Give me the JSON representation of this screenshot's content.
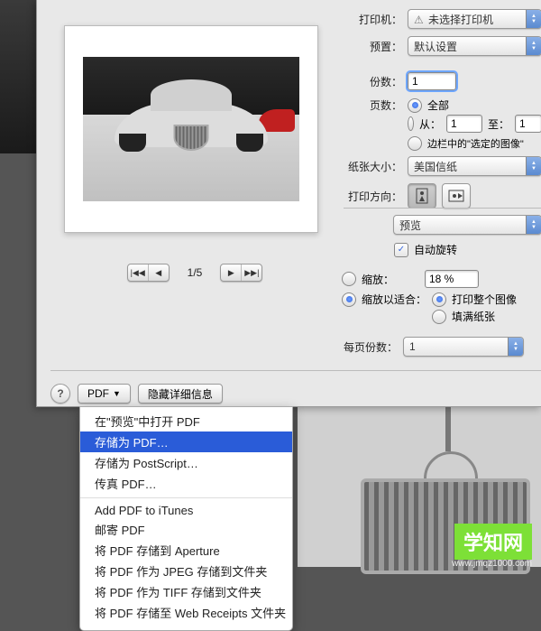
{
  "labels": {
    "printer": "打印机：",
    "preset": "预置：",
    "copies": "份数：",
    "pages": "页数：",
    "paper_size": "纸张大小：",
    "orientation": "打印方向：",
    "copies_per_page": "每页份数："
  },
  "printer": {
    "value": "未选择打印机"
  },
  "preset": {
    "value": "默认设置"
  },
  "copies": {
    "value": "1"
  },
  "pages": {
    "all": "全部",
    "from_label": "从：",
    "from_value": "1",
    "to_label": "至：",
    "to_value": "1",
    "sidebar_select": "边栏中的\"选定的图像\""
  },
  "paper_size": {
    "value": "美国信纸"
  },
  "preview_section": {
    "value": "预览"
  },
  "auto_rotate": "自动旋转",
  "scale": {
    "label": "缩放：",
    "value": "18 %"
  },
  "fit": {
    "label": "缩放以适合：",
    "print_whole": "打印整个图像",
    "fill_paper": "填满纸张"
  },
  "copies_per_page": {
    "value": "1"
  },
  "pager": {
    "text": "1/5"
  },
  "bottom": {
    "pdf_btn": "PDF",
    "hide_details": "隐藏详细信息"
  },
  "menu": {
    "open_in_preview": "在\"预览\"中打开 PDF",
    "save_as_pdf": "存储为 PDF…",
    "save_as_ps": "存储为 PostScript…",
    "fax_pdf": "传真 PDF…",
    "add_to_itunes": "Add PDF to iTunes",
    "mail_pdf": "邮寄 PDF",
    "save_to_aperture": "将 PDF 存储到 Aperture",
    "save_as_jpeg": "将 PDF 作为 JPEG 存储到文件夹",
    "save_as_tiff": "将 PDF 作为 TIFF 存储到文件夹",
    "save_to_web_receipts": "将 PDF 存储至 Web Receipts 文件夹"
  },
  "watermark": {
    "text": "学知网",
    "url": "www.jmqz1000.com"
  }
}
